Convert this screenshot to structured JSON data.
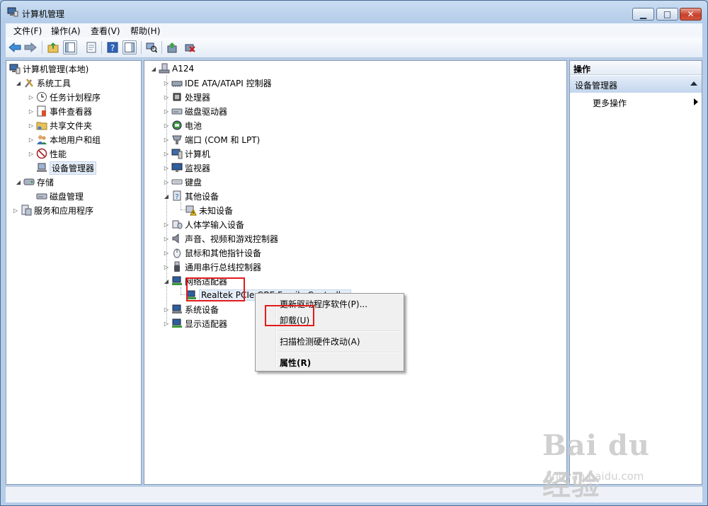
{
  "window": {
    "title": "计算机管理",
    "buttons": {
      "min": "▁",
      "max": "□",
      "close": "✕"
    }
  },
  "menu": [
    "文件(F)",
    "操作(A)",
    "查看(V)",
    "帮助(H)"
  ],
  "left_tree": [
    {
      "label": "计算机管理(本地)",
      "icon": "computer-mgmt-icon"
    },
    {
      "label": "系统工具",
      "icon": "tools-icon"
    },
    {
      "label": "任务计划程序",
      "icon": "clock-icon"
    },
    {
      "label": "事件查看器",
      "icon": "event-viewer-icon"
    },
    {
      "label": "共享文件夹",
      "icon": "shared-folder-icon"
    },
    {
      "label": "本地用户和组",
      "icon": "users-icon"
    },
    {
      "label": "性能",
      "icon": "performance-icon"
    },
    {
      "label": "设备管理器",
      "icon": "device-manager-icon"
    },
    {
      "label": "存储",
      "icon": "storage-icon"
    },
    {
      "label": "磁盘管理",
      "icon": "disk-mgmt-icon"
    },
    {
      "label": "服务和应用程序",
      "icon": "services-icon"
    }
  ],
  "device_tree": {
    "root": "A124",
    "items": [
      "IDE ATA/ATAPI 控制器",
      "处理器",
      "磁盘驱动器",
      "电池",
      "端口 (COM 和 LPT)",
      "计算机",
      "监视器",
      "键盘",
      "其他设备",
      "未知设备",
      "人体学输入设备",
      "声音、视频和游戏控制器",
      "鼠标和其他指针设备",
      "通用串行总线控制器",
      "网络适配器",
      "Realtek PCIe GBE Family Controller",
      "系统设备",
      "显示适配器"
    ]
  },
  "context_menu": {
    "update": "更新驱动程序软件(P)...",
    "uninstall": "卸载(U)",
    "scan": "扫描检测硬件改动(A)",
    "properties": "属性(R)"
  },
  "actions": {
    "header": "操作",
    "section": "设备管理器",
    "more": "更多操作"
  },
  "watermark": {
    "logo": "Bai du 经验",
    "url": "jingyan.baidu.com"
  }
}
